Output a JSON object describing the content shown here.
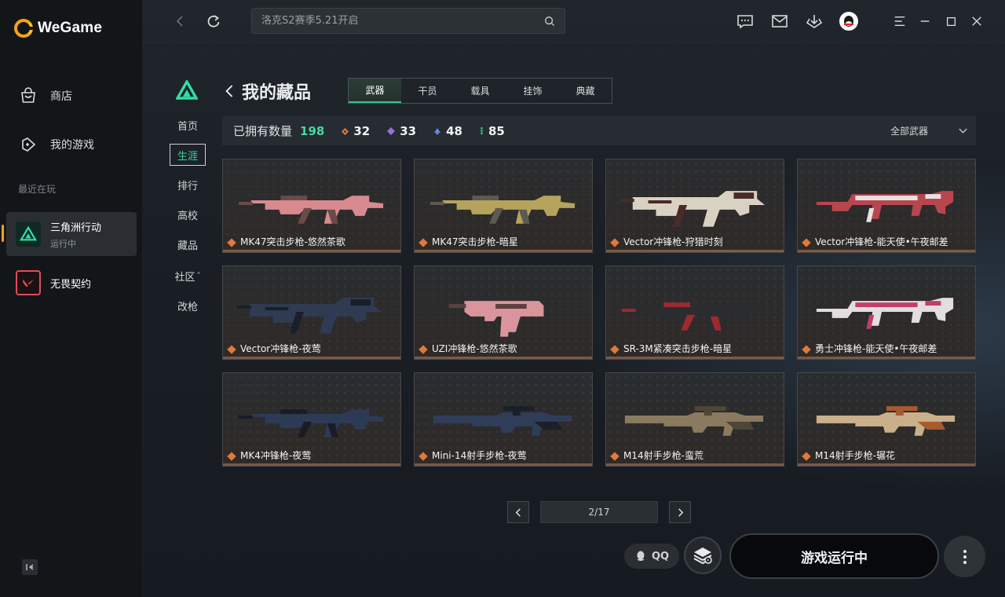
{
  "app": {
    "name": "WeGame"
  },
  "sidebar": {
    "store": "商店",
    "my_games": "我的游戏",
    "recent_label": "最近在玩",
    "games": [
      {
        "name": "三角洲行动",
        "status": "运行中",
        "active": true
      },
      {
        "name": "无畏契约",
        "status": "",
        "active": false
      }
    ]
  },
  "topbar": {
    "search_placeholder": "洛克S2赛季5.21开启"
  },
  "game_nav": [
    {
      "label": "首页",
      "active": false
    },
    {
      "label": "生涯",
      "active": true
    },
    {
      "label": "排行",
      "active": false
    },
    {
      "label": "高校",
      "active": false
    },
    {
      "label": "藏品",
      "active": false
    },
    {
      "label": "社区",
      "active": false
    },
    {
      "label": "改枪",
      "active": false
    }
  ],
  "page": {
    "title": "我的藏品",
    "tabs": [
      {
        "label": "武器",
        "active": true
      },
      {
        "label": "干员",
        "active": false
      },
      {
        "label": "载具",
        "active": false
      },
      {
        "label": "挂饰",
        "active": false
      },
      {
        "label": "典藏",
        "active": false
      }
    ],
    "owned_label": "已拥有数量",
    "owned_count": "198",
    "rarity_counts": [
      {
        "color": "#e07a3c",
        "count": "32"
      },
      {
        "color": "#9a6ee0",
        "count": "33"
      },
      {
        "color": "#5f8fe6",
        "count": "48"
      },
      {
        "color": "#3cc88f",
        "count": "85"
      }
    ],
    "filter": "全部武器"
  },
  "items": [
    {
      "name": "MK47突击步枪-悠然茶歌",
      "type": "ar",
      "c1": "#d98a8f",
      "c2": "#6b4a4a"
    },
    {
      "name": "MK47突击步枪-暗星",
      "type": "ar",
      "c1": "#b6a35c",
      "c2": "#5d5a52"
    },
    {
      "name": "Vector冲锋枪-狩猎时刻",
      "type": "smg",
      "c1": "#d9d2c3",
      "c2": "#4a2b28"
    },
    {
      "name": "Vector冲锋枪-能天使•午夜邮差",
      "type": "smg2",
      "c1": "#b8464f",
      "c2": "#e8e2e2"
    },
    {
      "name": "Vector冲锋枪-夜莺",
      "type": "smg",
      "c1": "#2f3b52",
      "c2": "#1a1f28"
    },
    {
      "name": "UZI冲锋枪-悠然茶歌",
      "type": "uzi",
      "c1": "#d9959b",
      "c2": "#5d3f3f"
    },
    {
      "name": "SR-3M紧凑突击步枪-暗星",
      "type": "ar",
      "c1": "#2b2c30",
      "c2": "#9c2a2f"
    },
    {
      "name": "勇士冲锋枪-能天使•午夜邮差",
      "type": "smg2",
      "c1": "#e2dedd",
      "c2": "#c23d6c"
    },
    {
      "name": "MK4冲锋枪-夜莺",
      "type": "ar",
      "c1": "#2d3a55",
      "c2": "#181c24"
    },
    {
      "name": "Mini-14射手步枪-夜莺",
      "type": "rifle",
      "c1": "#2f3d59",
      "c2": "#1b1f27"
    },
    {
      "name": "M14射手步枪-蛮荒",
      "type": "rifle",
      "c1": "#8a7a60",
      "c2": "#4f4638"
    },
    {
      "name": "M14射手步枪-辗花",
      "type": "rifle",
      "c1": "#c9b08b",
      "c2": "#a85a2f"
    }
  ],
  "pager": {
    "text": "2/17"
  },
  "bottom": {
    "qq": "QQ",
    "play": "游戏运行中"
  }
}
